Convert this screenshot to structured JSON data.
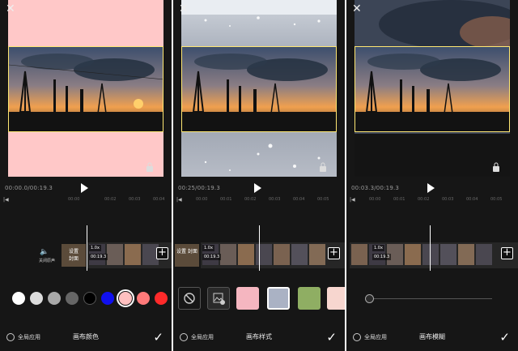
{
  "panels": [
    {
      "close_glyph": "✕",
      "canvas_background": "#ffc8c8",
      "timecode": "00:00.0/00:19.3",
      "ruler_marks": [
        "00:00",
        "00:02",
        "00:03",
        "00:04"
      ],
      "ruler_prefix": "|◀",
      "cover_label": "设置\n封面",
      "mute_label": "关闭原声",
      "clip_tag": "1.0x",
      "clip_duration": "00:19.3",
      "swatches": [
        "#ffffff",
        "#dcdcdc",
        "#a8a8a8",
        "#666666",
        "#000000",
        "#1010ee",
        "#ffc0c0",
        "#ff7a7a",
        "#ff2a2a"
      ],
      "selected_swatch_index": 6,
      "apply_all_label": "全局应用",
      "title": "画布颜色"
    },
    {
      "close_glyph": "✕",
      "timecode": "00:25/00:19.3",
      "ruler_marks": [
        "00:00",
        "00:01",
        "00:02",
        "00:03",
        "00:04",
        "00:05"
      ],
      "ruler_prefix": "|◀",
      "cover_label": "设置\n封面",
      "clip_tag": "1.0x",
      "clip_duration": "00:19.3",
      "style_tiles": [
        "none",
        "custom-image",
        "pink-pattern",
        "water-sparkle",
        "green-pattern",
        "peach-pattern"
      ],
      "apply_all_label": "全局应用",
      "title": "画布样式"
    },
    {
      "close_glyph": "✕",
      "timecode": "00:03.3/00:19.3",
      "ruler_marks": [
        "00:00",
        "00:01",
        "00:02",
        "00:03",
        "00:04",
        "00:05"
      ],
      "ruler_prefix": "|◀",
      "clip_tag": "1.0x",
      "clip_duration": "00:19.3",
      "blur_level": 0,
      "apply_all_label": "全局应用",
      "title": "画布模糊"
    }
  ],
  "colors": {
    "accent_frame": "#ffe873",
    "panel_bg": "#161616"
  }
}
